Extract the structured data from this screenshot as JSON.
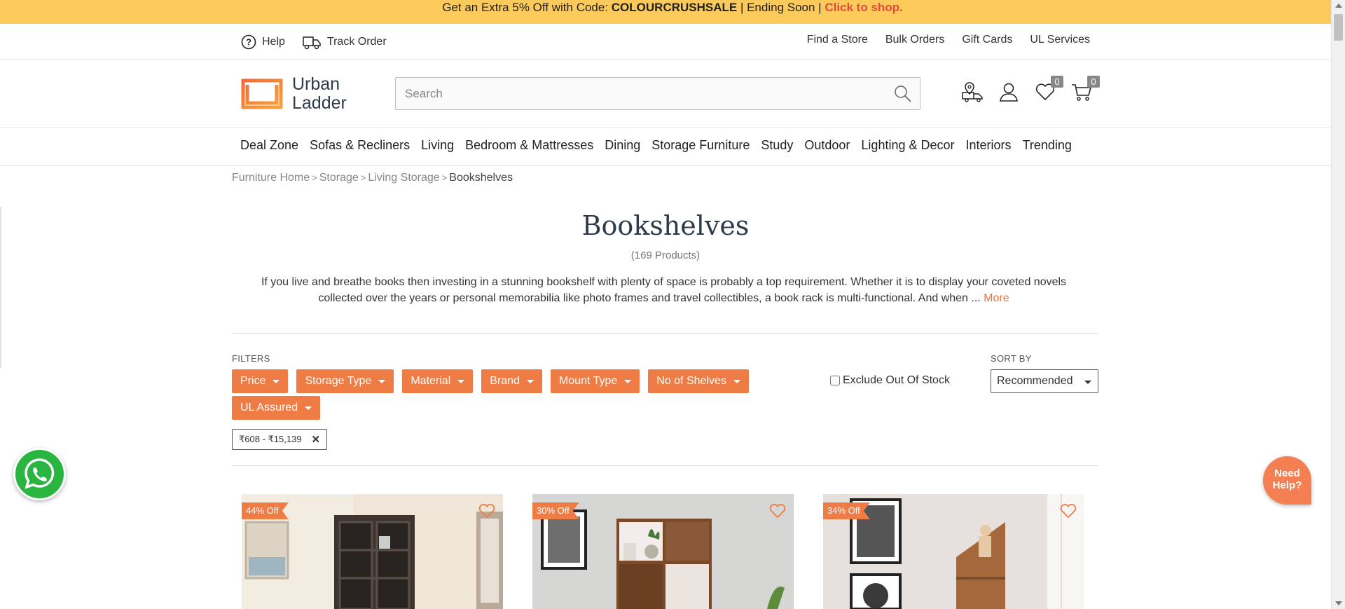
{
  "promo": {
    "text_before": "Get an Extra 5% Off with Code: ",
    "code": "COLOURCRUSHSALE",
    "text_middle": " | Ending Soon | ",
    "cta": "Click to shop."
  },
  "utility": {
    "help_label": "Help",
    "track_label": "Track Order",
    "links": [
      "Find a Store",
      "Bulk Orders",
      "Gift Cards",
      "UL Services"
    ]
  },
  "header": {
    "logo_line1": "Urban",
    "logo_line2": "Ladder",
    "search_placeholder": "Search",
    "wishlist_count": "0",
    "cart_count": "0"
  },
  "nav": [
    "Deal Zone",
    "Sofas & Recliners",
    "Living",
    "Bedroom & Mattresses",
    "Dining",
    "Storage Furniture",
    "Study",
    "Outdoor",
    "Lighting & Decor",
    "Interiors",
    "Trending"
  ],
  "breadcrumb": {
    "items": [
      "Furniture Home",
      "Storage",
      "Living Storage"
    ],
    "current": "Bookshelves"
  },
  "page": {
    "title": "Bookshelves",
    "count": "(169 Products)",
    "description": "If you live and breathe books then investing in a stunning bookshelf with plenty of space is probably a top requirement. Whether it is to display your coveted novels collected over the years or personal memorabilia like photo frames and travel collectibles, a book rack is multi-functional. And when ... ",
    "more": "More"
  },
  "filters": {
    "label": "FILTERS",
    "buttons": [
      "Price",
      "Storage Type",
      "Material",
      "Brand",
      "Mount Type",
      "No of Shelves",
      "UL Assured"
    ],
    "exclude_label": "Exclude Out Of Stock",
    "exclude_checked": false,
    "active_chip": "₹608 - ₹15,139"
  },
  "sort": {
    "label": "SORT BY",
    "selected": "Recommended"
  },
  "products": [
    {
      "discount": "44% Off"
    },
    {
      "discount": "30% Off"
    },
    {
      "discount": "34% Off"
    }
  ],
  "help_bubble": {
    "line1": "Need",
    "line2": "Help?"
  },
  "colors": {
    "promo_bg": "#fcca5a",
    "accent": "#ef7b45",
    "cta_red": "#e34b3f",
    "whatsapp": "#2ab540"
  }
}
